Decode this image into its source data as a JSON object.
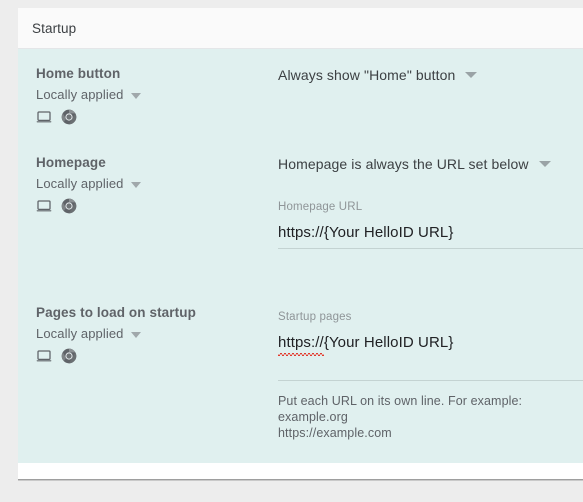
{
  "card": {
    "header": {
      "title": "Startup"
    }
  },
  "policies": [
    {
      "name": "Home button",
      "source": "Locally applied",
      "icons": [
        "monitor-icon",
        "chrome-icon"
      ],
      "value_label": "Always show \"Home\" button"
    },
    {
      "name": "Homepage",
      "source": "Locally applied",
      "icons": [
        "monitor-icon",
        "chrome-icon"
      ],
      "value_label": "Homepage is always the URL set below",
      "field_label": "Homepage URL",
      "field_scheme": "https://",
      "field_rest": "{Your HelloID URL}"
    },
    {
      "name": "Pages to load on startup",
      "source": "Locally applied",
      "icons": [
        "monitor-icon",
        "chrome-icon"
      ],
      "field_label": "Startup pages",
      "field_scheme": "https://",
      "field_rest": "{Your HelloID URL}",
      "helper": {
        "line1": "Put each URL on its own line. For example:",
        "line2": "example.org",
        "line3": "https://example.com"
      }
    }
  ],
  "colors": {
    "highlight_background": "#e0f0ef",
    "header_background": "#fafafa",
    "page_background": "#ededed",
    "primary_text": "#3c4043",
    "secondary_text": "#5f6368",
    "muted_text": "#8f9598",
    "spellcheck_underline": "#e23b2e"
  }
}
